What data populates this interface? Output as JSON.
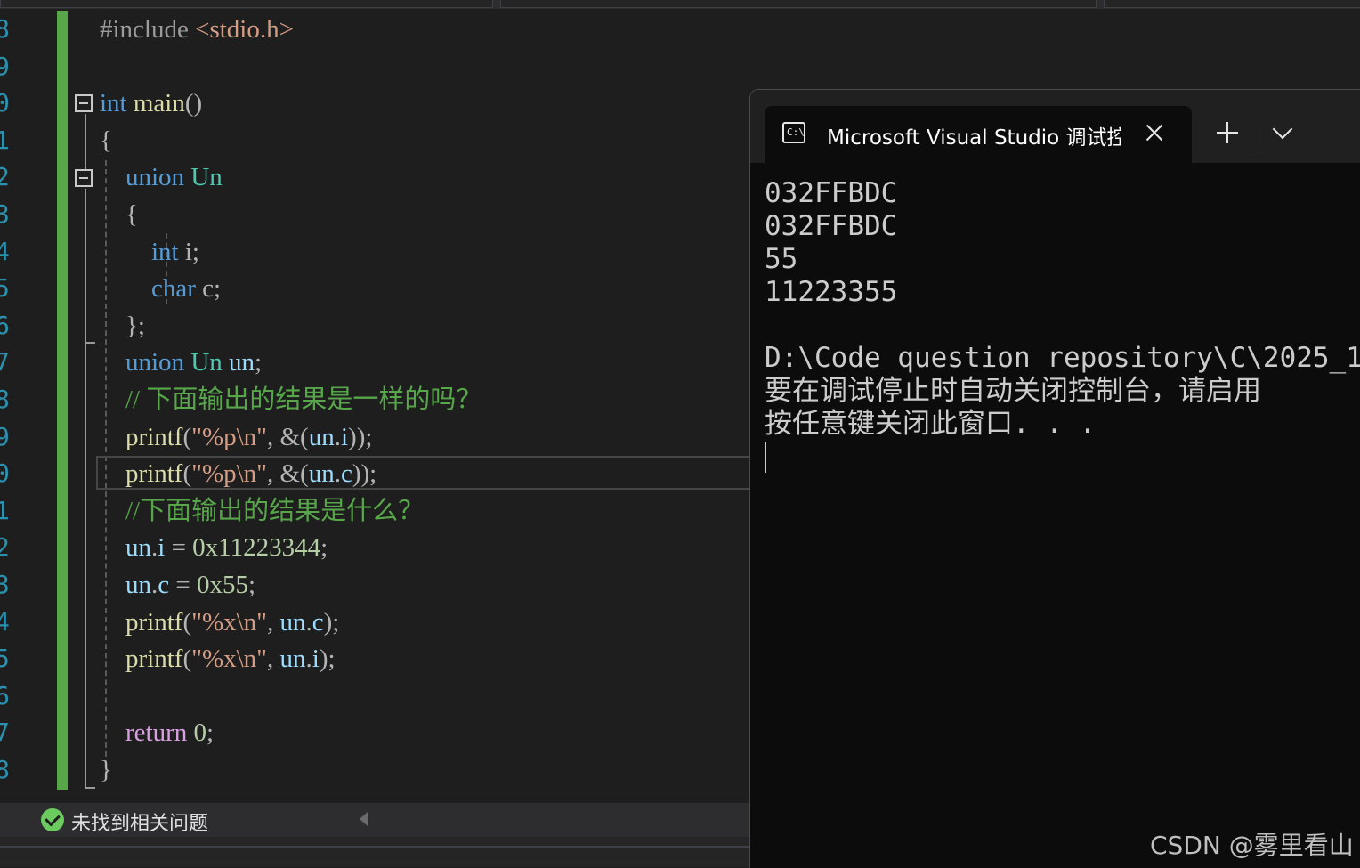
{
  "editor": {
    "line_numbers": [
      "8",
      "9",
      "0",
      "1",
      "2",
      "3",
      "4",
      "5",
      "6",
      "7",
      "8",
      "9",
      "0",
      "1",
      "2",
      "3",
      "4",
      "5",
      "6",
      "7",
      "8"
    ],
    "lines": [
      [
        {
          "t": "#include ",
          "c": "pp"
        },
        {
          "t": "<stdio.h>",
          "c": "str"
        }
      ],
      [],
      [
        {
          "t": "int",
          "c": "kw"
        },
        {
          "t": " ",
          "c": "pu"
        },
        {
          "t": "main",
          "c": "fn"
        },
        {
          "t": "()",
          "c": "pu"
        }
      ],
      [
        {
          "t": "{",
          "c": "pu"
        }
      ],
      [
        {
          "t": "    ",
          "c": "pu"
        },
        {
          "t": "union",
          "c": "kw"
        },
        {
          "t": " ",
          "c": "pu"
        },
        {
          "t": "Un",
          "c": "ty"
        }
      ],
      [
        {
          "t": "    {",
          "c": "pu"
        }
      ],
      [
        {
          "t": "        ",
          "c": "pu"
        },
        {
          "t": "int",
          "c": "kw"
        },
        {
          "t": " i;",
          "c": "pu"
        }
      ],
      [
        {
          "t": "        ",
          "c": "pu"
        },
        {
          "t": "char",
          "c": "kw"
        },
        {
          "t": " c;",
          "c": "pu"
        }
      ],
      [
        {
          "t": "    };",
          "c": "pu"
        }
      ],
      [
        {
          "t": "    ",
          "c": "pu"
        },
        {
          "t": "union",
          "c": "kw"
        },
        {
          "t": " ",
          "c": "pu"
        },
        {
          "t": "Un",
          "c": "ty"
        },
        {
          "t": " ",
          "c": "pu"
        },
        {
          "t": "un",
          "c": "var"
        },
        {
          "t": ";",
          "c": "pu"
        }
      ],
      [
        {
          "t": "    // 下面输出的结果是一样的吗？",
          "c": "cm"
        }
      ],
      [
        {
          "t": "    ",
          "c": "pu"
        },
        {
          "t": "printf",
          "c": "fn"
        },
        {
          "t": "(",
          "c": "pu"
        },
        {
          "t": "\"%p\\n\"",
          "c": "str"
        },
        {
          "t": ", &(",
          "c": "pu"
        },
        {
          "t": "un",
          "c": "var"
        },
        {
          "t": ".",
          "c": "pu"
        },
        {
          "t": "i",
          "c": "var"
        },
        {
          "t": "));",
          "c": "pu"
        }
      ],
      [
        {
          "t": "    ",
          "c": "pu"
        },
        {
          "t": "printf",
          "c": "fn"
        },
        {
          "t": "(",
          "c": "pu"
        },
        {
          "t": "\"%p\\n\"",
          "c": "str"
        },
        {
          "t": ", &(",
          "c": "pu"
        },
        {
          "t": "un",
          "c": "var"
        },
        {
          "t": ".",
          "c": "pu"
        },
        {
          "t": "c",
          "c": "var"
        },
        {
          "t": "));",
          "c": "pu"
        }
      ],
      [
        {
          "t": "    //下面输出的结果是什么？",
          "c": "cm"
        }
      ],
      [
        {
          "t": "    ",
          "c": "pu"
        },
        {
          "t": "un",
          "c": "var"
        },
        {
          "t": ".",
          "c": "pu"
        },
        {
          "t": "i",
          "c": "var"
        },
        {
          "t": " = ",
          "c": "pu"
        },
        {
          "t": "0x11223344",
          "c": "num"
        },
        {
          "t": ";",
          "c": "pu"
        }
      ],
      [
        {
          "t": "    ",
          "c": "pu"
        },
        {
          "t": "un",
          "c": "var"
        },
        {
          "t": ".",
          "c": "pu"
        },
        {
          "t": "c",
          "c": "var"
        },
        {
          "t": " = ",
          "c": "pu"
        },
        {
          "t": "0x55",
          "c": "num"
        },
        {
          "t": ";",
          "c": "pu"
        }
      ],
      [
        {
          "t": "    ",
          "c": "pu"
        },
        {
          "t": "printf",
          "c": "fn"
        },
        {
          "t": "(",
          "c": "pu"
        },
        {
          "t": "\"%x\\n\"",
          "c": "str"
        },
        {
          "t": ", ",
          "c": "pu"
        },
        {
          "t": "un",
          "c": "var"
        },
        {
          "t": ".",
          "c": "pu"
        },
        {
          "t": "c",
          "c": "var"
        },
        {
          "t": ");",
          "c": "pu"
        }
      ],
      [
        {
          "t": "    ",
          "c": "pu"
        },
        {
          "t": "printf",
          "c": "fn"
        },
        {
          "t": "(",
          "c": "pu"
        },
        {
          "t": "\"%x\\n\"",
          "c": "str"
        },
        {
          "t": ", ",
          "c": "pu"
        },
        {
          "t": "un",
          "c": "var"
        },
        {
          "t": ".",
          "c": "pu"
        },
        {
          "t": "i",
          "c": "var"
        },
        {
          "t": ");",
          "c": "pu"
        }
      ],
      [],
      [
        {
          "t": "    ",
          "c": "pu"
        },
        {
          "t": "return",
          "c": "ctl"
        },
        {
          "t": " ",
          "c": "pu"
        },
        {
          "t": "0",
          "c": "num"
        },
        {
          "t": ";",
          "c": "pu"
        }
      ],
      [
        {
          "t": "}",
          "c": "pu"
        }
      ]
    ]
  },
  "status": {
    "message": "未找到相关问题"
  },
  "terminal": {
    "tab_title": "Microsoft Visual Studio 调试控制台",
    "tab_icon_text": "C:\\",
    "output_lines": [
      "032FFBDC",
      "032FFBDC",
      "55",
      "11223355",
      "",
      "D:\\Code question repository\\C\\2025_1",
      "要在调试停止时自动关闭控制台，请启用",
      "按任意键关闭此窗口. . ."
    ]
  },
  "watermark": "CSDN @雾里看山",
  "colors": {
    "keyword": "#569cd6",
    "type": "#4ec9b0",
    "function": "#dcdcaa",
    "string": "#d69d85",
    "number": "#b5cea8",
    "comment": "#57a64a",
    "change_bar": "#57a64a",
    "editor_bg": "#1e1e1e",
    "terminal_bg": "#0c0c0c"
  }
}
